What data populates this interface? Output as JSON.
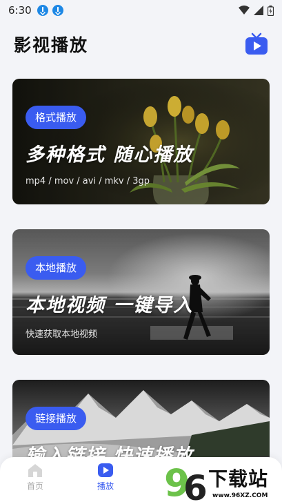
{
  "status_bar": {
    "time": "6:30"
  },
  "header": {
    "title": "影视播放",
    "tv_icon": "tv-play-icon"
  },
  "cards": [
    {
      "tag": "格式播放",
      "headline": "多种格式  随心播放",
      "subtitle": "mp4 / mov / avi / mkv / 3gp"
    },
    {
      "tag": "本地播放",
      "headline": "本地视频  一键导入",
      "subtitle": "快速获取本地视频"
    },
    {
      "tag": "链接播放",
      "headline": "输入链接  快速播放",
      "subtitle": ""
    }
  ],
  "bottom_nav": {
    "items": [
      {
        "label": "首页",
        "icon": "home-icon",
        "active": false
      },
      {
        "label": "播放",
        "icon": "play-icon",
        "active": true
      }
    ]
  },
  "watermark": {
    "number": "96",
    "text": "下载站",
    "url": "www.96XZ.COM"
  },
  "colors": {
    "accent": "#3a5cf0",
    "background": "#f3f4f8"
  }
}
